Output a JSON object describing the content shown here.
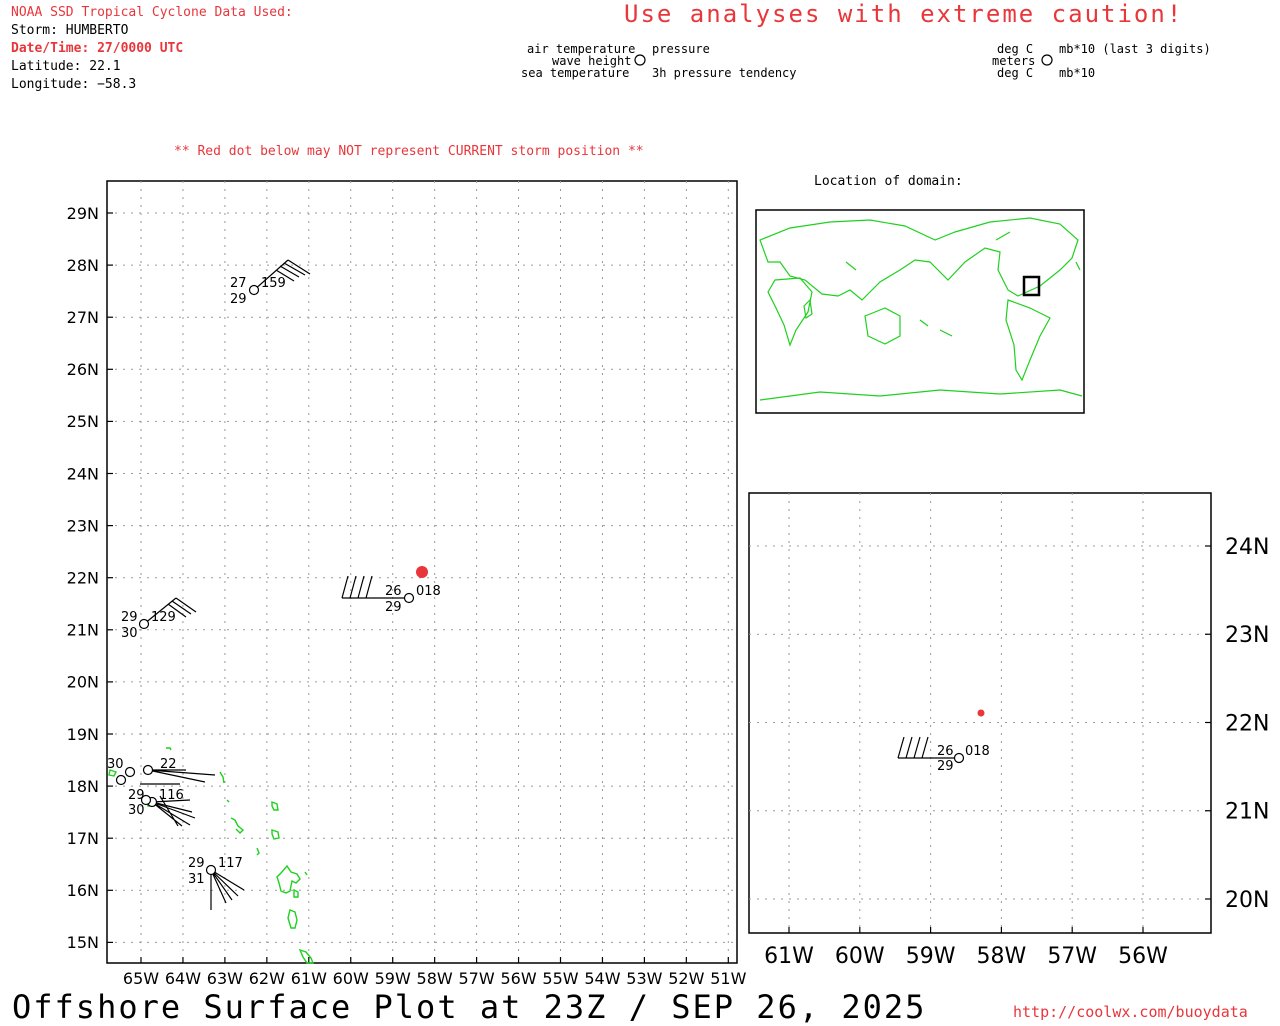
{
  "header": {
    "source_title": "NOAA SSD Tropical Cyclone Data Used:",
    "storm": "Storm: HUMBERTO",
    "datetime": "Date/Time: 27/0000 UTC",
    "latitude": "Latitude: 22.1",
    "longitude": "Longitude: −58.3",
    "caution": "Use analyses with extreme caution!",
    "red_dot_note": "** Red dot below may NOT represent CURRENT storm position **"
  },
  "legend_station": {
    "air_temperature": "air temperature",
    "wave_height": "wave height",
    "sea_temperature": "sea temperature",
    "pressure": "pressure",
    "pressure_tendency": "3h pressure tendency"
  },
  "legend_units": {
    "deg_c_top": "deg C",
    "meters": "meters",
    "deg_c_bottom": "deg C",
    "mb_last3": "mb*10 (last 3 digits)",
    "mb10": "mb*10"
  },
  "inset": {
    "title": "Location of domain:"
  },
  "main_map": {
    "lat_labels": [
      "29N",
      "28N",
      "27N",
      "26N",
      "25N",
      "24N",
      "23N",
      "22N",
      "21N",
      "20N",
      "19N",
      "18N",
      "17N",
      "16N",
      "15N"
    ],
    "lon_labels": [
      "65W",
      "64W",
      "63W",
      "62W",
      "61W",
      "60W",
      "59W",
      "58W",
      "57W",
      "56W",
      "55W",
      "54W",
      "53W",
      "52W",
      "51W"
    ],
    "storm_position": {
      "lat": 22.1,
      "lon": -58.3
    },
    "observations": [
      {
        "air": "27",
        "sea": "29",
        "pres": "159"
      },
      {
        "air": "26",
        "sea": "29",
        "pres": "018"
      },
      {
        "air": "29",
        "sea": "30",
        "pres": "129"
      },
      {
        "air": "29",
        "sea": "31",
        "pres": "117"
      },
      {
        "air": "30",
        "sea": "",
        "pres": "22"
      },
      {
        "air": "29",
        "sea": "30",
        "pres": "116"
      }
    ]
  },
  "zoom_map": {
    "lat_labels": [
      "24N",
      "23N",
      "22N",
      "21N",
      "20N"
    ],
    "lon_labels": [
      "61W",
      "60W",
      "59W",
      "58W",
      "57W",
      "56W"
    ],
    "observation": {
      "air": "26",
      "sea": "29",
      "pres": "018"
    }
  },
  "footer": {
    "title": "Offshore Surface Plot at 23Z / SEP 26, 2025",
    "url": "http://coolwx.com/buoydata"
  },
  "colors": {
    "accent": "#e8363b",
    "land": "#1fd11f",
    "grid": "#999999"
  }
}
